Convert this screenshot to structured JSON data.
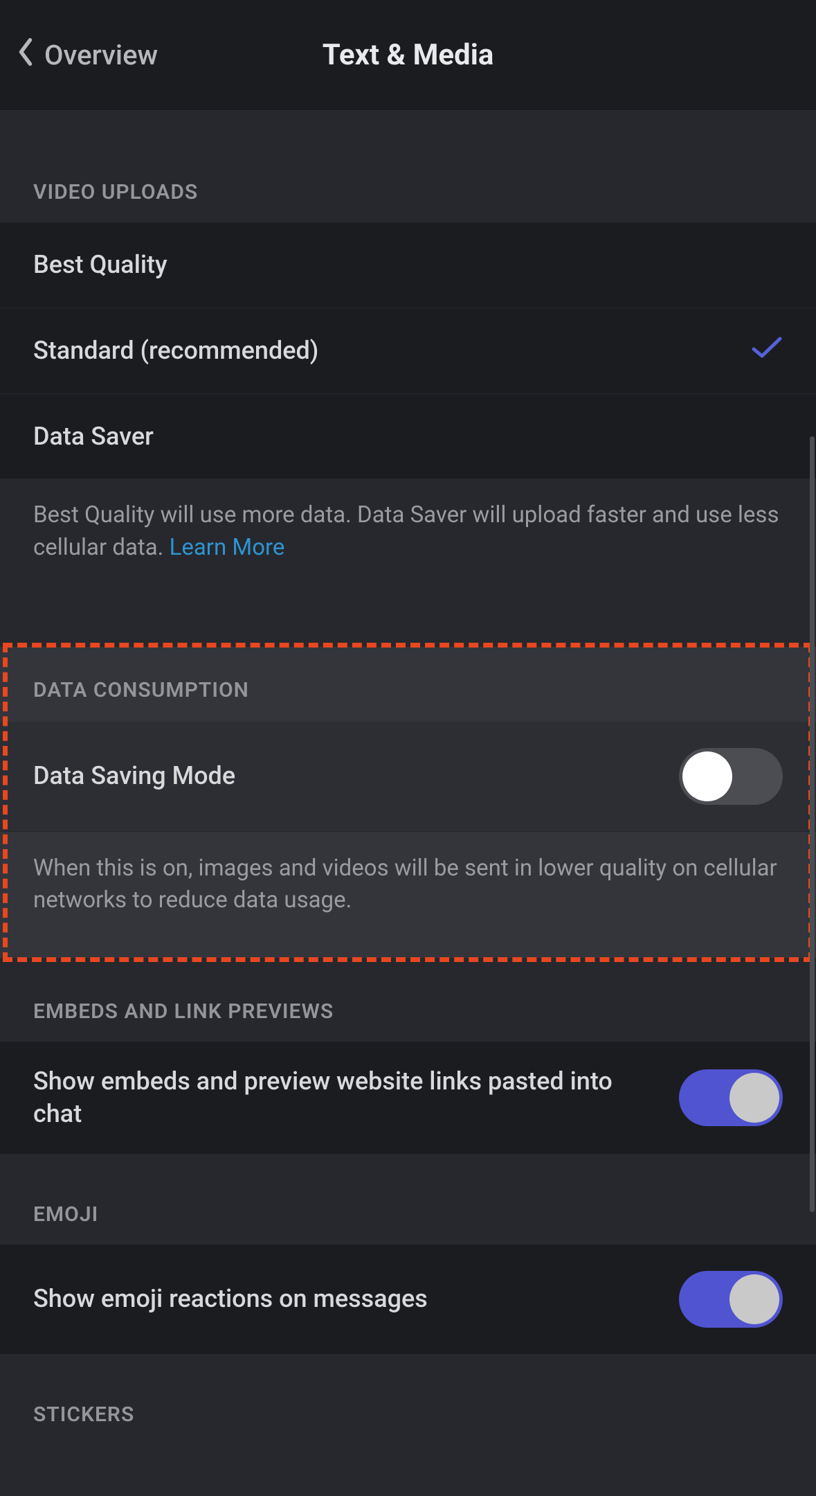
{
  "header": {
    "back_label": "Overview",
    "title": "Text & Media"
  },
  "video_uploads": {
    "header": "VIDEO UPLOADS",
    "options": [
      {
        "label": "Best Quality",
        "selected": false
      },
      {
        "label": "Standard (recommended)",
        "selected": true
      },
      {
        "label": "Data Saver",
        "selected": false
      }
    ],
    "footer": "Best Quality will use more data. Data Saver will upload faster and use less cellular data. ",
    "learn_more": "Learn More"
  },
  "data_consumption": {
    "header": "DATA CONSUMPTION",
    "toggle_label": "Data Saving Mode",
    "toggle_on": false,
    "footer": "When this is on, images and videos will be sent in lower quality on cellular networks to reduce data usage."
  },
  "embeds": {
    "header": "EMBEDS AND LINK PREVIEWS",
    "toggle_label": "Show embeds and preview website links pasted into chat",
    "toggle_on": true
  },
  "emoji": {
    "header": "EMOJI",
    "toggle_label": "Show emoji reactions on messages",
    "toggle_on": true
  },
  "stickers": {
    "header": "STICKERS"
  }
}
